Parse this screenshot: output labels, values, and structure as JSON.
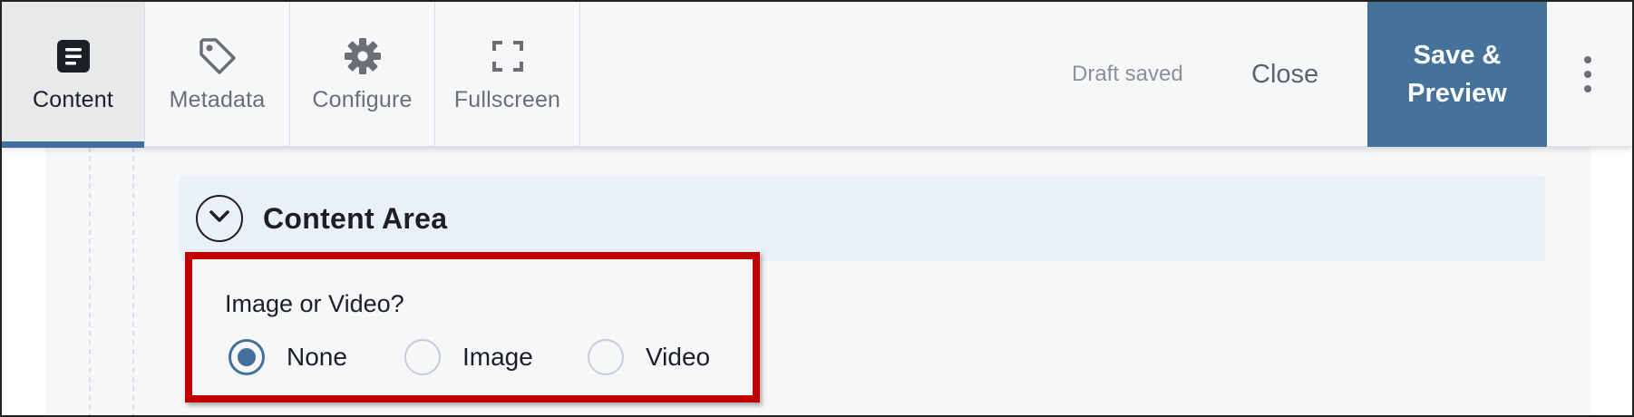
{
  "toolbar": {
    "tabs": [
      {
        "label": "Content",
        "icon": "document-icon",
        "active": true
      },
      {
        "label": "Metadata",
        "icon": "tag-icon",
        "active": false
      },
      {
        "label": "Configure",
        "icon": "gear-icon",
        "active": false
      },
      {
        "label": "Fullscreen",
        "icon": "fullscreen-icon",
        "active": false
      }
    ],
    "status": "Draft saved",
    "close_label": "Close",
    "save_preview_label": "Save & Preview",
    "more_icon": "vertical-ellipsis-icon"
  },
  "section": {
    "title": "Content Area",
    "toggle_icon": "chevron-down-icon"
  },
  "field": {
    "label": "Image or Video?",
    "options": [
      {
        "label": "None",
        "checked": true
      },
      {
        "label": "Image",
        "checked": false
      },
      {
        "label": "Video",
        "checked": false
      }
    ]
  },
  "colors": {
    "accent": "#44729b",
    "highlight": "#c00000",
    "section_bg": "#e9f0f7",
    "toolbar_bg": "#f6f7f9"
  }
}
